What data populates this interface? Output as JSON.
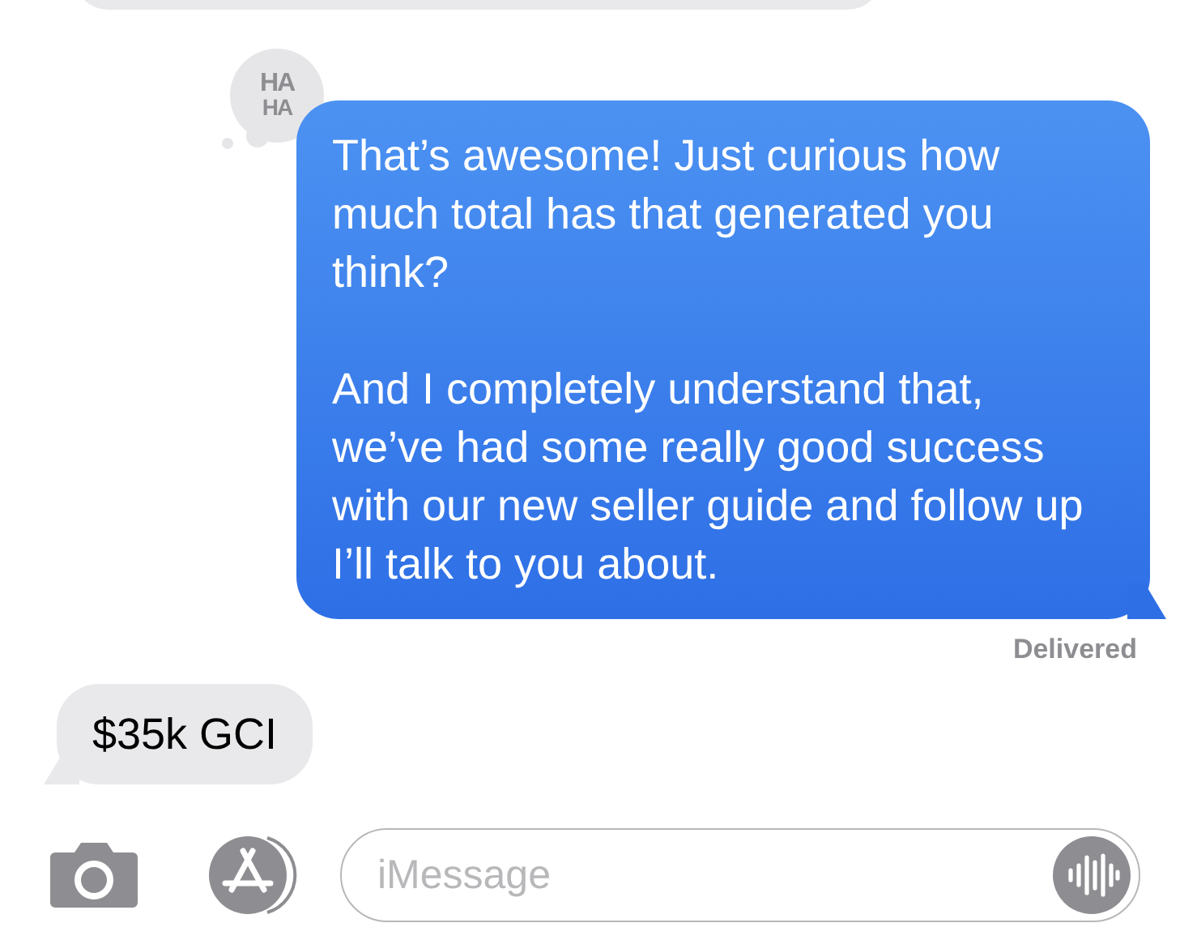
{
  "thread": {
    "previous_bubble": {
      "kind": "received"
    },
    "tapback": {
      "lines": [
        "HA",
        "HA"
      ]
    },
    "messages": [
      {
        "kind": "sent",
        "paragraphs": [
          "That’s awesome! Just curious how much total has that generated you think?",
          "And I completely understand that, we’ve had some really good success with our new seller guide and follow up I’ll talk to you about."
        ]
      },
      {
        "kind": "received",
        "paragraphs": [
          "$35k GCI"
        ]
      }
    ],
    "status": "Delivered"
  },
  "compose": {
    "placeholder": "iMessage"
  }
}
